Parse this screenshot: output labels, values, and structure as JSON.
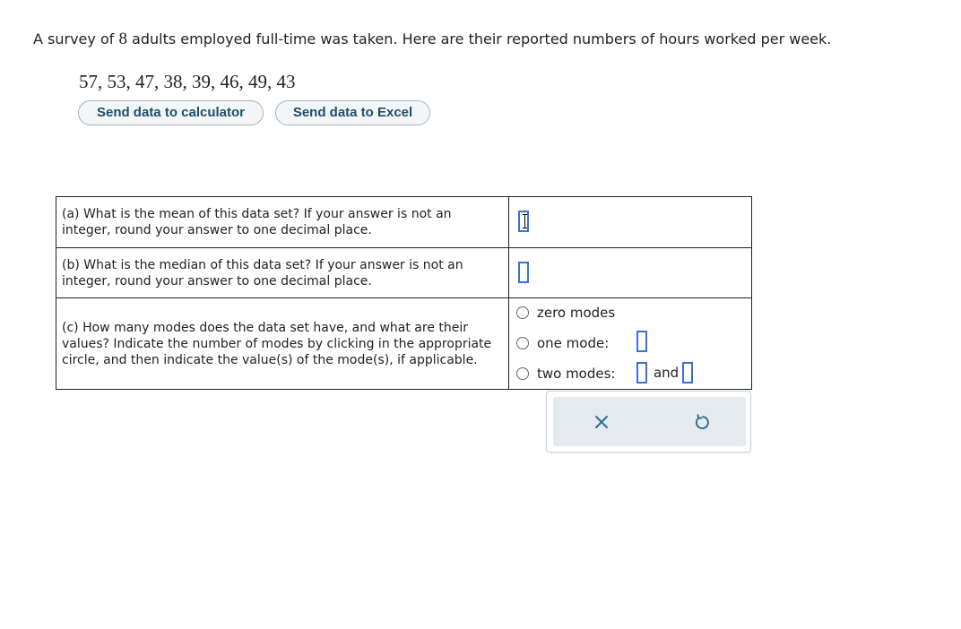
{
  "prompt": {
    "before": "A survey of ",
    "count": "8",
    "after": " adults employed full-time was taken. Here are their reported numbers of hours worked per week."
  },
  "dataset": "57, 53, 47, 38, 39, 46, 49, 43",
  "buttons": {
    "calculator": "Send data to calculator",
    "excel": "Send data to Excel"
  },
  "questions": {
    "a": "(a) What is the mean of this data set? If your answer is not an integer, round your answer to one decimal place.",
    "b": "(b) What is the median of this data set? If your answer is not an integer, round your answer to one decimal place.",
    "c": "(c) How many modes does the data set have, and what are their values? Indicate the number of modes by clicking in the appropriate circle, and then indicate the value(s) of the mode(s), if applicable."
  },
  "answers": {
    "mean_value": "",
    "median_value": "",
    "modes": {
      "zero_label": "zero modes",
      "one_label": "one mode:",
      "two_label": "two modes:",
      "and_label": "and",
      "one_value": "",
      "two_value_1": "",
      "two_value_2": ""
    }
  },
  "actions": {
    "close_icon": "close-icon",
    "undo_icon": "undo-icon"
  },
  "colors": {
    "accent_box": "#3b6fd8",
    "button_text": "#1f4e69",
    "icon": "#2f6f8f",
    "panel_bg": "#e4eaee"
  }
}
